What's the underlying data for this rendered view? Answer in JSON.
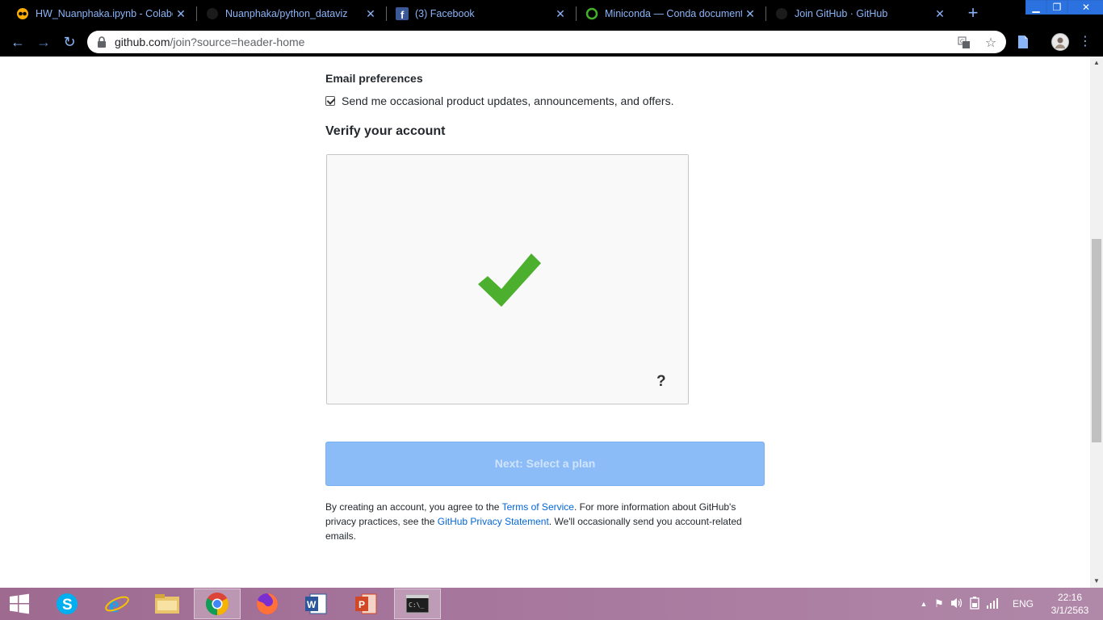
{
  "browser": {
    "tabs": [
      {
        "title": "HW_Nuanphaka.ipynb - Colabor",
        "favicon": "colab-icon"
      },
      {
        "title": "Nuanphaka/python_dataviz",
        "favicon": "github-icon"
      },
      {
        "title": "(3) Facebook",
        "favicon": "facebook-icon"
      },
      {
        "title": "Miniconda — Conda documenta",
        "favicon": "conda-icon"
      },
      {
        "title": "Join GitHub · GitHub",
        "favicon": "github-icon"
      }
    ],
    "url_host": "github.com",
    "url_path": "/join?source=header-home",
    "accent": "#8ab4f8"
  },
  "page": {
    "email_heading": "Email preferences",
    "email_checkbox_label": "Send me occasional product updates, announcements, and offers.",
    "email_checked": true,
    "verify_heading": "Verify your account",
    "captcha_help": "?",
    "next_button": "Next: Select a plan",
    "legal": {
      "part1": "By creating an account, you agree to the ",
      "tos_link": "Terms of Service",
      "part2": ". For more information about GitHub's privacy practices, see the ",
      "privacy_link": "GitHub Privacy Statement",
      "part3": ". We'll occasionally send you account-related emails."
    },
    "check_color": "#4caf2e",
    "button_color": "#8cbcf7",
    "link_color": "#0366d6"
  },
  "taskbar": {
    "apps": [
      "windows-start",
      "skype",
      "internet-explorer",
      "file-explorer",
      "chrome",
      "firefox",
      "word",
      "powerpoint",
      "command-prompt"
    ],
    "language": "ENG",
    "time": "22:16",
    "date": "3/1/2563"
  }
}
